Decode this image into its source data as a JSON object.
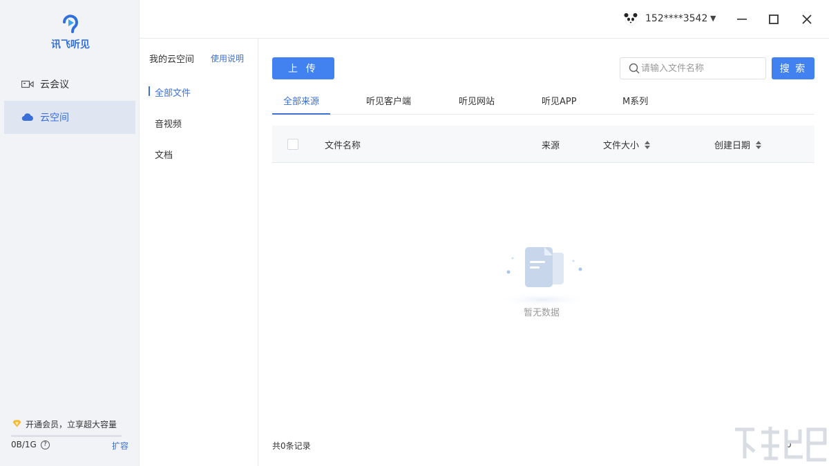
{
  "app": {
    "logo_text": "讯飞听见"
  },
  "nav": {
    "meeting": "云会议",
    "cloud": "云空间"
  },
  "vip": {
    "promo": "开通会员，立享超大容量",
    "quota": "0B/1G",
    "expand": "扩容",
    "used_fraction": 0
  },
  "user": {
    "phone": "152****3542"
  },
  "cloud_panel": {
    "title": "我的云空间",
    "help": "使用说明",
    "items": [
      "全部文件",
      "音视频",
      "文档"
    ]
  },
  "toolbar": {
    "upload": "上 传",
    "search_placeholder": "请输入文件名称",
    "search": "搜 索"
  },
  "tabs": [
    "全部来源",
    "听见客户端",
    "听见网站",
    "听见APP",
    "M系列"
  ],
  "table": {
    "headers": {
      "name": "文件名称",
      "source": "来源",
      "size": "文件大小",
      "date": "创建日期"
    }
  },
  "empty": {
    "text": "暂无数据"
  },
  "footer": {
    "total": "共0条记录",
    "page": "0"
  },
  "colors": {
    "accent": "#4282f0",
    "nav_bg": "#f1f3f6",
    "active_bg": "#dfe6f2"
  }
}
